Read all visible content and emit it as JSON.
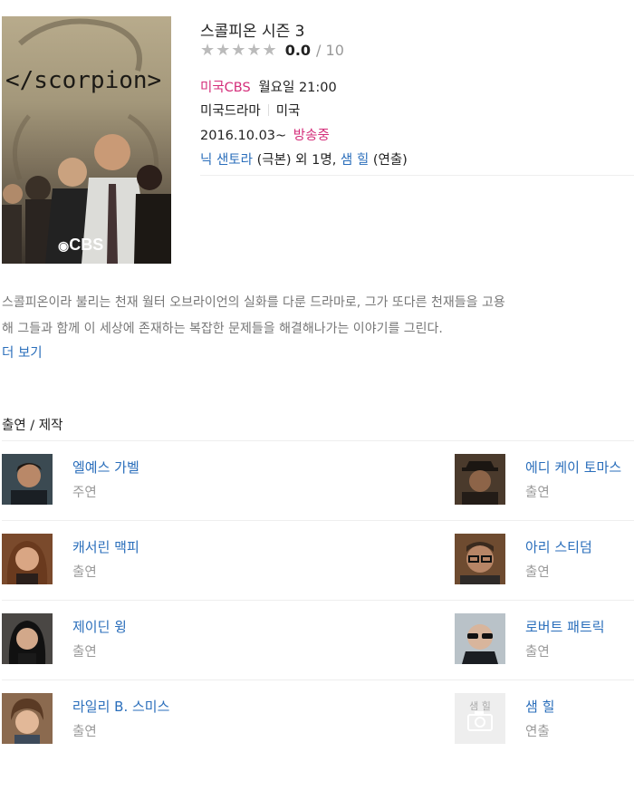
{
  "poster": {
    "title_text": "</scorpion>",
    "network_logo": "CBS"
  },
  "show": {
    "title": "스콜피온 시즌 3",
    "rating": {
      "stars": "★★★★★",
      "score": "0.0",
      "max": "/ 10"
    },
    "broadcast": {
      "network": "미국CBS",
      "schedule": "월요일 21:00"
    },
    "genre": "미국드라마",
    "country": "미국",
    "period": {
      "start": "2016.10.03~",
      "status": "방송중"
    },
    "credits": {
      "writer": "닉 샌토라",
      "writer_role": "(극본) 외 1명,",
      "director": "샘 힐",
      "director_role": "(연출)"
    }
  },
  "synopsis": {
    "line1": "스콜피온이라 불리는 천재 월터 오브라이언의 실화를 다룬 드라마로, 그가 또다른 천재들을 고용",
    "line2": "해 그들과 함께 이 세상에 존재하는 복잡한 문제들을 해결해나가는 이야기를 그린다.",
    "more": "더 보기"
  },
  "cast_section": {
    "title": "출연 / 제작",
    "people": [
      {
        "name": "엘예스 가벨",
        "role": "주연"
      },
      {
        "name": "에디 케이 토마스",
        "role": "출연"
      },
      {
        "name": "캐서린 맥피",
        "role": "출연"
      },
      {
        "name": "아리 스티덤",
        "role": "출연"
      },
      {
        "name": "제이딘 윙",
        "role": "출연"
      },
      {
        "name": "로버트 패트릭",
        "role": "출연"
      },
      {
        "name": "라일리 B. 스미스",
        "role": "출연"
      },
      {
        "name": "샘 힐",
        "role": "연출",
        "placeholder_label": "샘 힐"
      }
    ]
  },
  "icons": {
    "star": "star-icon",
    "camera": "camera-icon"
  }
}
